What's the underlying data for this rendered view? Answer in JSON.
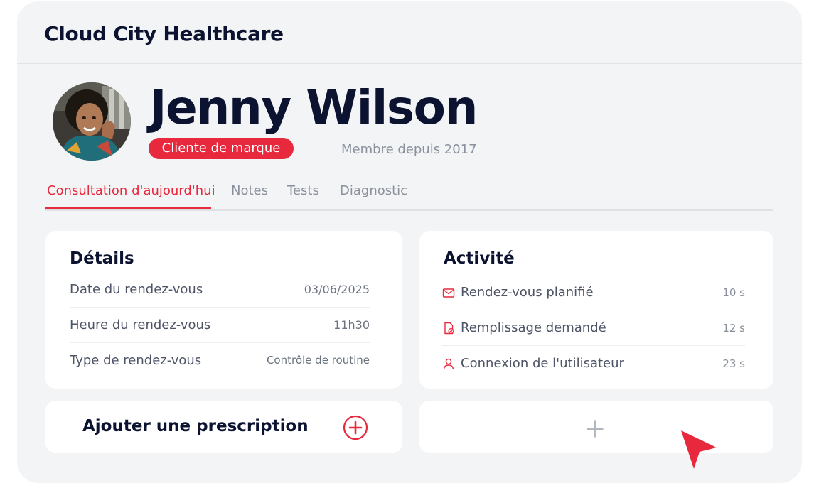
{
  "app": {
    "title": "Cloud City Healthcare"
  },
  "patient": {
    "name": "Jenny Wilson",
    "badge": "Cliente de marque",
    "member_since": "Membre depuis 2017"
  },
  "tabs": [
    {
      "label": "Consultation d'aujourd'hui",
      "active": true
    },
    {
      "label": "Notes",
      "active": false
    },
    {
      "label": "Tests",
      "active": false
    },
    {
      "label": "Diagnostic",
      "active": false
    }
  ],
  "details": {
    "title": "Détails",
    "rows": [
      {
        "label": "Date du rendez-vous",
        "value": "03/06/2025"
      },
      {
        "label": "Heure du rendez-vous",
        "value": "11h30"
      },
      {
        "label": "Type de rendez-vous",
        "value": "Contrôle de routine"
      }
    ]
  },
  "activity": {
    "title": "Activité",
    "items": [
      {
        "icon": "envelope-icon",
        "label": "Rendez-vous planifié",
        "time": "10 s"
      },
      {
        "icon": "document-check-icon",
        "label": "Remplissage demandé",
        "time": "12 s"
      },
      {
        "icon": "user-icon",
        "label": "Connexion de l'utilisateur",
        "time": "23 s"
      }
    ]
  },
  "prescription": {
    "label": "Ajouter une prescription",
    "icon": "plus-circle-icon"
  },
  "empty_card": {
    "icon": "plus-icon"
  },
  "colors": {
    "accent": "#e8283d",
    "background": "#f3f4f6",
    "card": "#ffffff",
    "heading": "#0b1330",
    "muted": "#8a909c"
  }
}
